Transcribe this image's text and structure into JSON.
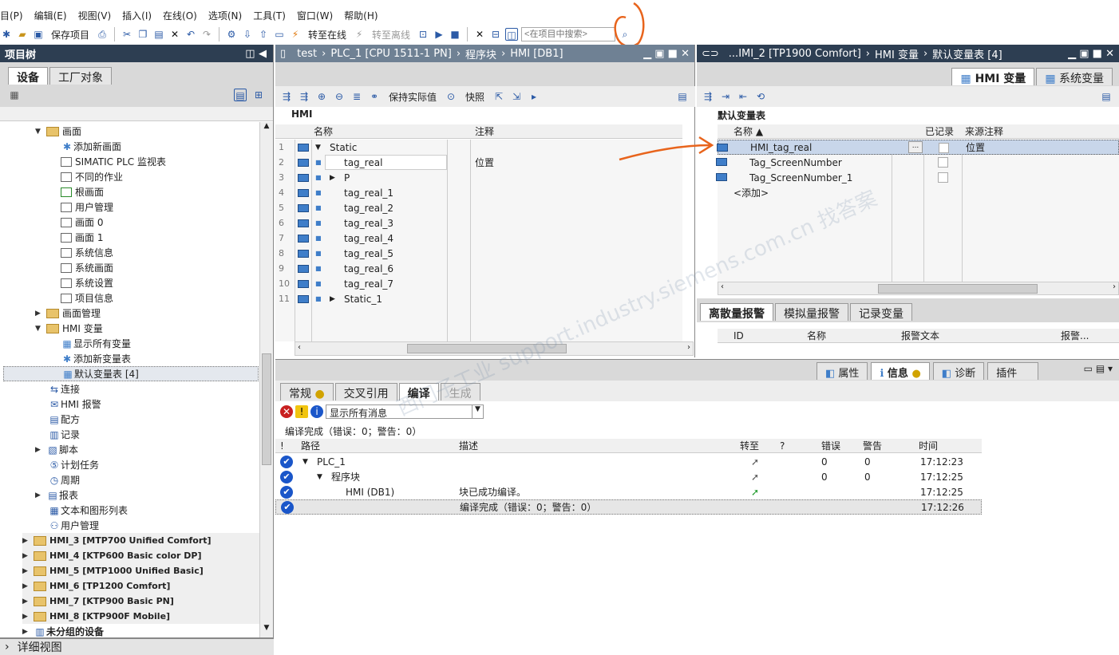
{
  "menu": [
    "目(P)",
    "编辑(E)",
    "视图(V)",
    "插入(I)",
    "在线(O)",
    "选项(N)",
    "工具(T)",
    "窗口(W)",
    "帮助(H)"
  ],
  "toolbar": {
    "save": "保存项目",
    "go_online": "转至在线",
    "go_offline": "转至离线",
    "search_placeholder": "<在项目中搜索>"
  },
  "tree": {
    "title": "项目树",
    "tab_devices": "设备",
    "tab_plant": "工厂对象",
    "items": [
      "画面",
      "添加新画面",
      "SIMATIC PLC 监视表",
      "不同的作业",
      "根画面",
      "用户管理",
      "画面 0",
      "画面 1",
      "系统信息",
      "系统画面",
      "系统设置",
      "项目信息",
      "画面管理",
      "HMI 变量",
      "显示所有变量",
      "添加新变量表",
      "默认变量表 [4]",
      "连接",
      "HMI 报警",
      "配方",
      "记录",
      "脚本",
      "计划任务",
      "周期",
      "报表",
      "文本和图形列表",
      "用户管理",
      "HMI_3 [MTP700 Unified Comfort]",
      "HMI_4 [KTP600 Basic color DP]",
      "HMI_5 [MTP1000 Unified Basic]",
      "HMI_6 [TP1200 Comfort]",
      "HMI_7 [KTP900 Basic PN]",
      "HMI_8 [KTP900F Mobile]",
      "未分组的设备"
    ],
    "detail": "详细视图"
  },
  "mid": {
    "breadcrumb": [
      "test",
      "PLC_1 [CPU 1511-1 PN]",
      "程序块",
      "HMI [DB1]"
    ],
    "keep": "保持实际值",
    "snapshot": "快照",
    "db_title": "HMI",
    "col_name": "名称",
    "col_comment": "注释",
    "rows": [
      {
        "n": "1",
        "name": "Static",
        "c": ""
      },
      {
        "n": "2",
        "name": "tag_real",
        "c": "位置"
      },
      {
        "n": "3",
        "name": "P",
        "c": ""
      },
      {
        "n": "4",
        "name": "tag_real_1",
        "c": ""
      },
      {
        "n": "5",
        "name": "tag_real_2",
        "c": ""
      },
      {
        "n": "6",
        "name": "tag_real_3",
        "c": ""
      },
      {
        "n": "7",
        "name": "tag_real_4",
        "c": ""
      },
      {
        "n": "8",
        "name": "tag_real_5",
        "c": ""
      },
      {
        "n": "9",
        "name": "tag_real_6",
        "c": ""
      },
      {
        "n": "10",
        "name": "tag_real_7",
        "c": ""
      },
      {
        "n": "11",
        "name": "Static_1",
        "c": ""
      }
    ]
  },
  "right": {
    "breadcrumb": [
      "...IMI_2 [TP1900 Comfort]",
      "HMI 变量",
      "默认变量表 [4]"
    ],
    "tab_hmi": "HMI 变量",
    "tab_sys": "系统变量",
    "table_title": "默认变量表",
    "col_name": "名称 ▲",
    "col_logged": "已记录",
    "col_src": "来源注释",
    "rows": [
      {
        "name": "HMI_tag_real",
        "src": "位置"
      },
      {
        "name": "Tag_ScreenNumber",
        "src": ""
      },
      {
        "name": "Tag_ScreenNumber_1",
        "src": ""
      }
    ],
    "add": "<添加>",
    "alarm_tabs": [
      "离散量报警",
      "模拟量报警",
      "记录变量"
    ],
    "alarm_cols": [
      "ID",
      "名称",
      "报警文本",
      "报警..."
    ]
  },
  "bottom": {
    "tabs_right": [
      "属性",
      "信息",
      "诊断",
      "插件"
    ],
    "tabs": [
      "常规",
      "交叉引用",
      "编译",
      "生成"
    ],
    "filter": "显示所有消息",
    "summary": "编译完成（错误：0；警告：0）",
    "cols": [
      "!",
      "路径",
      "描述",
      "转至",
      "?",
      "错误",
      "警告",
      "时间"
    ],
    "rows": [
      {
        "path": "PLC_1",
        "desc": "",
        "err": "0",
        "warn": "0",
        "time": "17:12:23"
      },
      {
        "path": "程序块",
        "desc": "",
        "err": "0",
        "warn": "0",
        "time": "17:12:25"
      },
      {
        "path": "HMI (DB1)",
        "desc": "块已成功编译。",
        "err": "",
        "warn": "",
        "time": "17:12:25"
      },
      {
        "path": "",
        "desc": "编译完成（错误：0；警告：0）",
        "err": "",
        "warn": "",
        "time": "17:12:26"
      }
    ]
  },
  "watermark": "西门子工业 support.industry.siemens.com.cn 找答案"
}
